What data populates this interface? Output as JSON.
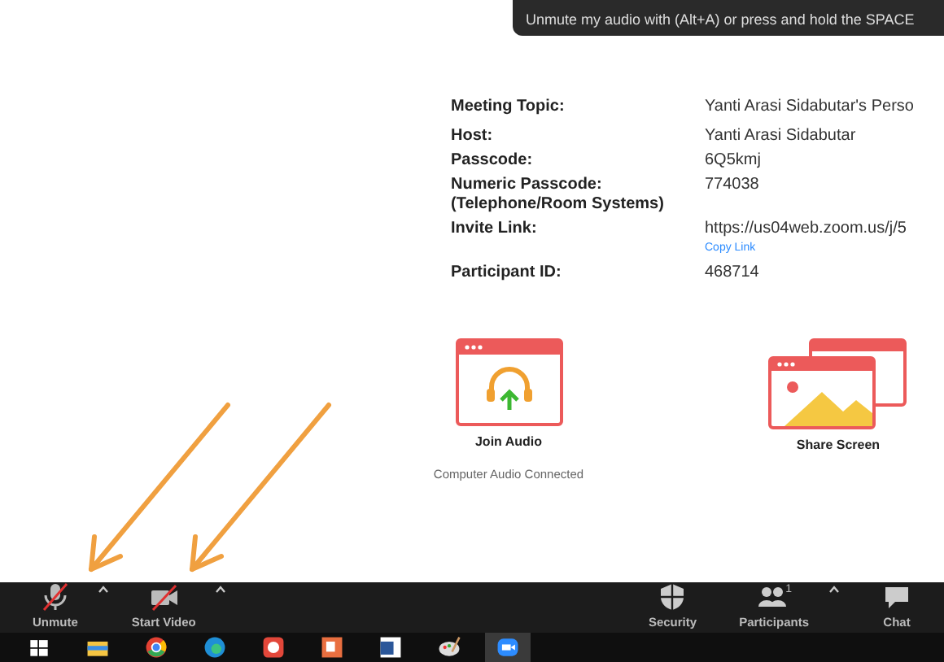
{
  "tooltip": "Unmute my audio with (Alt+A) or press and hold the SPACE",
  "details": [
    {
      "label": "Meeting Topic:",
      "value": "Yanti Arasi Sidabutar's Perso"
    },
    {
      "label": "Host:",
      "value": "Yanti Arasi Sidabutar"
    },
    {
      "label": "Passcode:",
      "value": "6Q5kmj"
    },
    {
      "label": "Numeric Passcode:\n(Telephone/Room Systems)",
      "value": "774038"
    },
    {
      "label": "Invite Link:",
      "value": "https://us04web.zoom.us/j/5",
      "link": "Copy Link"
    },
    {
      "label": "Participant ID:",
      "value": "468714"
    }
  ],
  "actions": [
    {
      "kind": "audio",
      "label": "Join Audio",
      "note": "Computer Audio Connected"
    },
    {
      "kind": "share",
      "label": "Share Screen"
    }
  ],
  "toolbar_left": [
    {
      "kind": "mic-off",
      "label": "Unmute"
    },
    {
      "kind": "video-off",
      "label": "Start Video"
    }
  ],
  "toolbar_right": [
    {
      "kind": "security",
      "label": "Security"
    },
    {
      "kind": "participants",
      "label": "Participants",
      "count": "1",
      "menu": true
    },
    {
      "kind": "chat",
      "label": "Chat"
    }
  ],
  "taskbar": [
    {
      "kind": "start",
      "selected": false
    },
    {
      "kind": "files",
      "selected": false
    },
    {
      "kind": "chrome",
      "selected": false
    },
    {
      "kind": "edge",
      "selected": false
    },
    {
      "kind": "red",
      "selected": false
    },
    {
      "kind": "ppt",
      "selected": false
    },
    {
      "kind": "word",
      "selected": false
    },
    {
      "kind": "paint",
      "selected": false
    },
    {
      "kind": "zoom",
      "selected": true
    }
  ]
}
